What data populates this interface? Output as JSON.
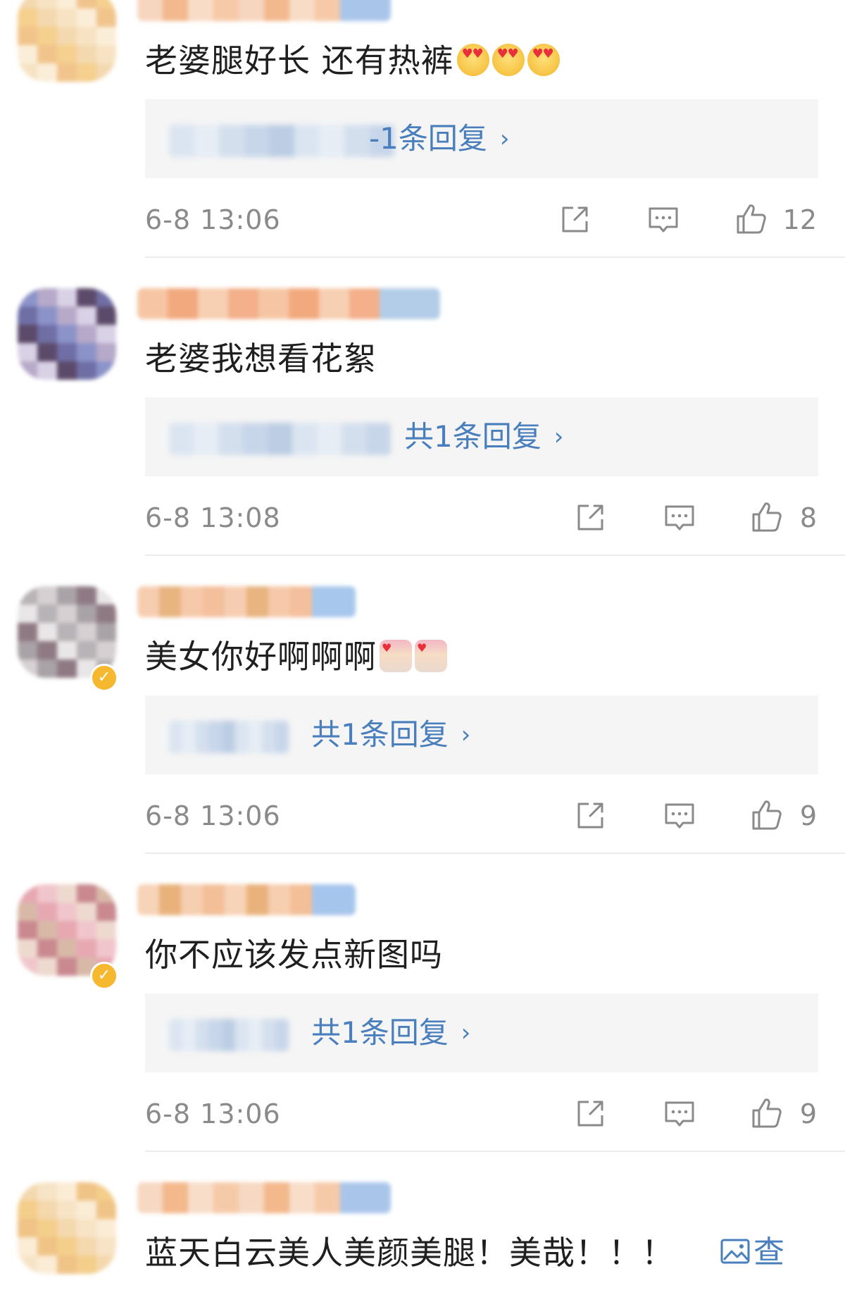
{
  "comments": [
    {
      "text": "老婆腿好长 还有热裤",
      "emojis": [
        "heart-eyes-emoji",
        "heart-eyes-emoji",
        "heart-eyes-emoji"
      ],
      "reply_summary": "-1条回复",
      "timestamp": "6-8 13:06",
      "likes": "12",
      "verified": false,
      "avatar_colors": [
        "#f4d9b0",
        "#f1c48c",
        "#f7e3c4",
        "#f5d08e",
        "#fbeed9"
      ],
      "username_colors": [
        "#f7d6c0",
        "#f6c9a8",
        "#f8dcc6",
        "#f3b98e",
        "#a9c6ea"
      ]
    },
    {
      "text": "老婆我想看花絮",
      "emojis": [],
      "reply_summary": "共1条回复",
      "timestamp": "6-8 13:08",
      "likes": "8",
      "verified": false,
      "avatar_colors": [
        "#8c93c9",
        "#5c4a6a",
        "#b7a9c9",
        "#6f6fa6",
        "#d9d2e6"
      ],
      "username_colors": [
        "#f6c6a4",
        "#f3b08a",
        "#f7cfb2",
        "#f2a97e",
        "#b3cde8"
      ]
    },
    {
      "text": "美女你好啊啊啊",
      "emojis": [
        "bride-emoji",
        "bride-emoji"
      ],
      "reply_summary": "共1条回复",
      "timestamp": "6-8 13:06",
      "likes": "9",
      "verified": true,
      "avatar_colors": [
        "#b8b3b6",
        "#8f7a84",
        "#d6d0d2",
        "#e9e6e7",
        "#a9a2a6"
      ],
      "username_colors": [
        "#f7cdb2",
        "#f4bf9c",
        "#f6c9aa",
        "#e8b47f",
        "#a8c7ec"
      ]
    },
    {
      "text": "你不应该发点新图吗",
      "emojis": [],
      "reply_summary": "共1条回复",
      "timestamp": "6-8 13:06",
      "likes": "9",
      "verified": true,
      "avatar_colors": [
        "#e7a8b2",
        "#c9898f",
        "#f0c6cc",
        "#d8b9a8",
        "#eed9cf"
      ],
      "username_colors": [
        "#f7d3b8",
        "#f3bf98",
        "#f6ceb0",
        "#e9b27c",
        "#a6c5ec"
      ]
    },
    {
      "text": "蓝天白云美人美颜美腿！美哉！！！",
      "emojis": [],
      "view_image_label": "查",
      "reply_summary": "",
      "timestamp": "",
      "likes": "",
      "verified": false,
      "avatar_colors": [
        "#f4d8ae",
        "#f0c387",
        "#f7e4c6",
        "#f4ce8b",
        "#fbecd6"
      ],
      "username_colors": [
        "#f7d8c2",
        "#f5caa9",
        "#f8ddc8",
        "#f3b88c",
        "#a9c6ea"
      ]
    }
  ],
  "icons": {
    "share": "share-icon",
    "comment": "comment-icon",
    "like": "thumbs-up-icon",
    "view_image": "image-icon"
  },
  "colors": {
    "link": "#4a7fbd",
    "meta": "#8a8a8a",
    "reply_bg": "#f5f5f5",
    "divider": "#ececec"
  }
}
